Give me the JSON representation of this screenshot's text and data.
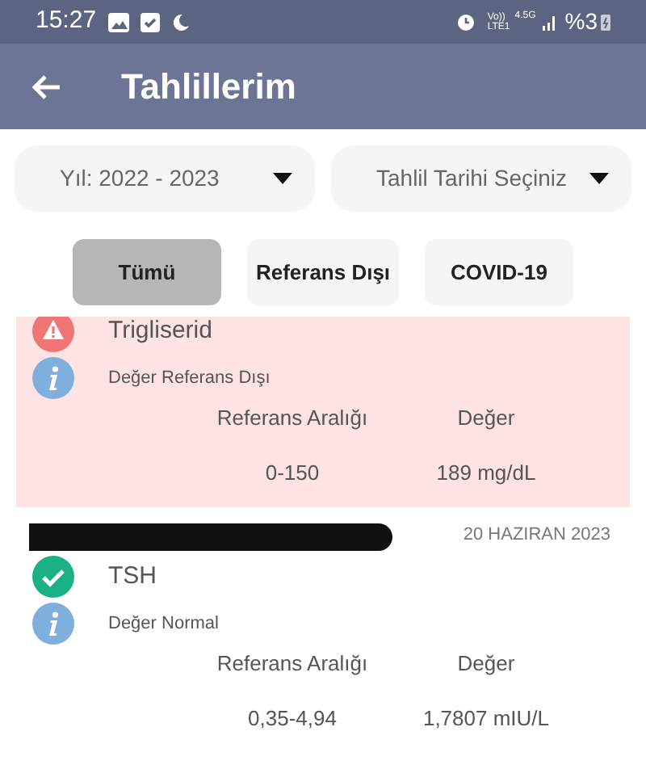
{
  "status_bar": {
    "time": "15:27",
    "network_top": "Vo))",
    "network_bottom": "LTE1",
    "network_type": "4.5G",
    "battery": "%3"
  },
  "header": {
    "title": "Tahlillerim"
  },
  "dropdowns": [
    {
      "value": "Yıl: 2022 - 2023"
    },
    {
      "value": "Tahlil Tarihi Seçiniz"
    }
  ],
  "filters": [
    {
      "label": "Tümü",
      "selected": true
    },
    {
      "label": "Referans Dışı",
      "selected": false
    },
    {
      "label": "COVID-19",
      "selected": false
    }
  ],
  "results": [
    {
      "kind": "out_of_range",
      "redacted": false,
      "name": "Trigliserid",
      "note": "Değer Referans Dışı",
      "range_header": "Referans Aralığı",
      "value_header": "Değer",
      "range": "0-150",
      "value": "189 mg/dL"
    },
    {
      "kind": "normal",
      "redacted": true,
      "date": "20 HAZIRAN 2023",
      "name": "TSH",
      "note": "Değer Normal",
      "range_header": "Referans Aralığı",
      "value_header": "Değer",
      "range": "0,35-4,94",
      "value": "1,7807 mIU/L"
    }
  ]
}
